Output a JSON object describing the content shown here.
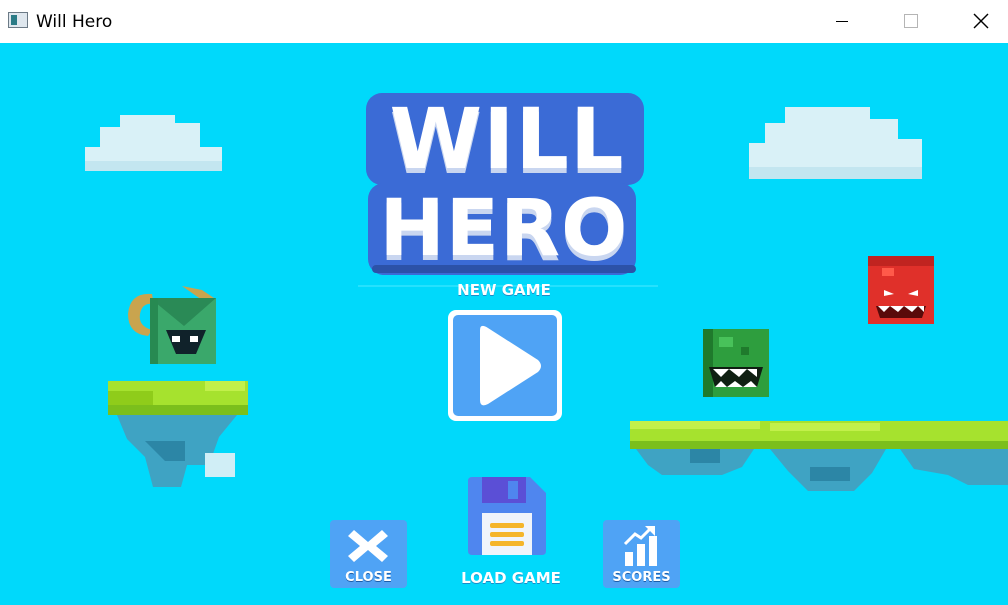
{
  "window": {
    "title": "Will Hero",
    "app_icon": "app-window-icon",
    "controls": [
      "minimize-icon",
      "maximize-icon",
      "close-icon"
    ]
  },
  "logo": {
    "line1": "WILL",
    "line2": "HERO"
  },
  "menu": {
    "new_game_label": "NEW GAME",
    "load_game_label": "LOAD GAME",
    "close_label": "CLOSE",
    "scores_label": "SCORES"
  },
  "icons": {
    "play": "play-icon",
    "save": "floppy-disk-icon",
    "close": "x-icon",
    "scores": "bar-chart-icon"
  },
  "colors": {
    "sky": "#00d9fb",
    "button_blue": "#4fa3f5",
    "grass": "#a6e22e",
    "rock": "#3fa3c3",
    "orc_green": "#2e9e3e",
    "orc_red": "#e0302a"
  }
}
